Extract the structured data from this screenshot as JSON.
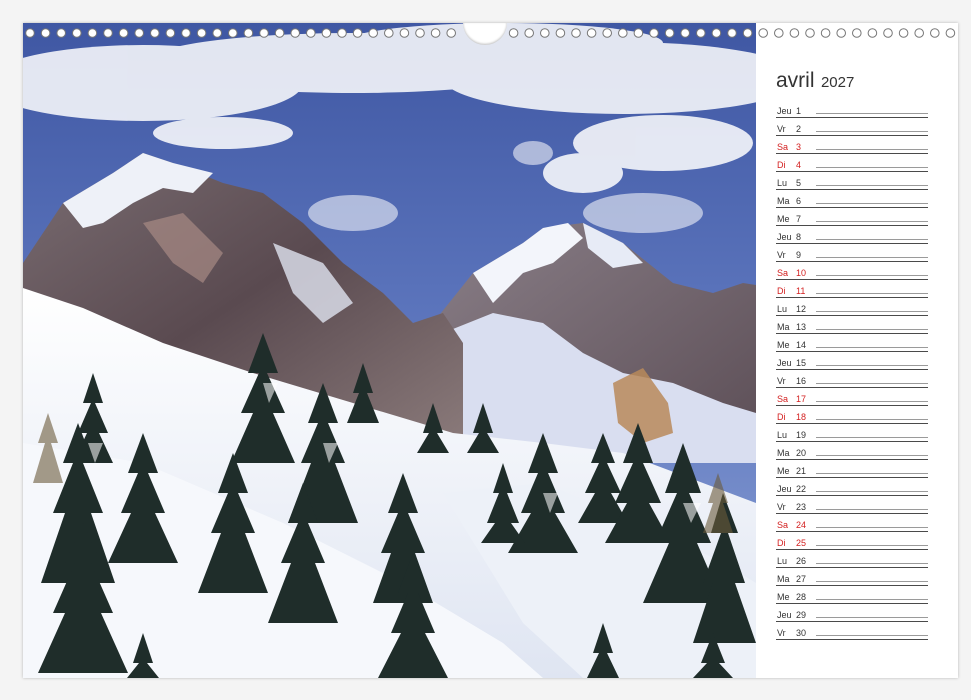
{
  "calendar": {
    "month": "avril",
    "year": "2027",
    "days": [
      {
        "name": "Jeu",
        "num": "1",
        "weekend": false
      },
      {
        "name": "Vr",
        "num": "2",
        "weekend": false
      },
      {
        "name": "Sa",
        "num": "3",
        "weekend": true
      },
      {
        "name": "Di",
        "num": "4",
        "weekend": true
      },
      {
        "name": "Lu",
        "num": "5",
        "weekend": false
      },
      {
        "name": "Ma",
        "num": "6",
        "weekend": false
      },
      {
        "name": "Me",
        "num": "7",
        "weekend": false
      },
      {
        "name": "Jeu",
        "num": "8",
        "weekend": false
      },
      {
        "name": "Vr",
        "num": "9",
        "weekend": false
      },
      {
        "name": "Sa",
        "num": "10",
        "weekend": true
      },
      {
        "name": "Di",
        "num": "11",
        "weekend": true
      },
      {
        "name": "Lu",
        "num": "12",
        "weekend": false
      },
      {
        "name": "Ma",
        "num": "13",
        "weekend": false
      },
      {
        "name": "Me",
        "num": "14",
        "weekend": false
      },
      {
        "name": "Jeu",
        "num": "15",
        "weekend": false
      },
      {
        "name": "Vr",
        "num": "16",
        "weekend": false
      },
      {
        "name": "Sa",
        "num": "17",
        "weekend": true
      },
      {
        "name": "Di",
        "num": "18",
        "weekend": true
      },
      {
        "name": "Lu",
        "num": "19",
        "weekend": false
      },
      {
        "name": "Ma",
        "num": "20",
        "weekend": false
      },
      {
        "name": "Me",
        "num": "21",
        "weekend": false
      },
      {
        "name": "Jeu",
        "num": "22",
        "weekend": false
      },
      {
        "name": "Vr",
        "num": "23",
        "weekend": false
      },
      {
        "name": "Sa",
        "num": "24",
        "weekend": true
      },
      {
        "name": "Di",
        "num": "25",
        "weekend": true
      },
      {
        "name": "Lu",
        "num": "26",
        "weekend": false
      },
      {
        "name": "Ma",
        "num": "27",
        "weekend": false
      },
      {
        "name": "Me",
        "num": "28",
        "weekend": false
      },
      {
        "name": "Jeu",
        "num": "29",
        "weekend": false
      },
      {
        "name": "Vr",
        "num": "30",
        "weekend": false
      }
    ]
  },
  "colors": {
    "weekend": "#d32020",
    "weekday": "#333333"
  }
}
